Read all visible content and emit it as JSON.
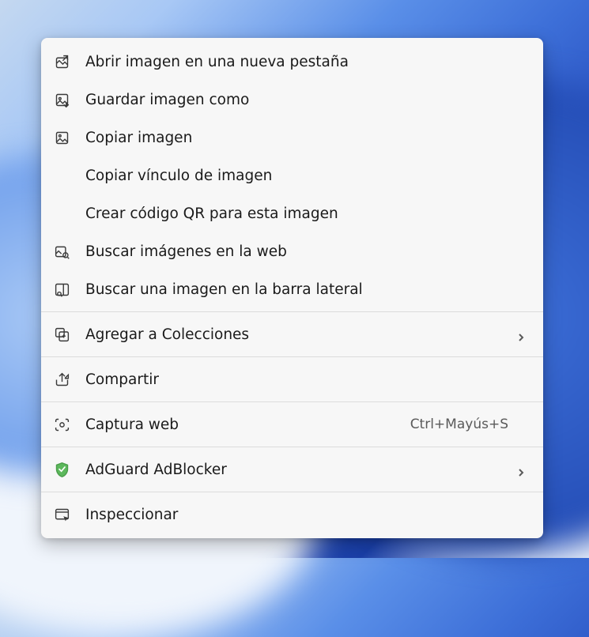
{
  "contextMenu": {
    "items": [
      {
        "label": "Abrir imagen en una nueva pestaña",
        "icon": "open-image-icon"
      },
      {
        "label": "Guardar imagen como",
        "icon": "save-image-icon"
      },
      {
        "label": "Copiar imagen",
        "icon": "copy-image-icon"
      },
      {
        "label": "Copiar vínculo de imagen",
        "icon": null
      },
      {
        "label": "Crear código QR para esta imagen",
        "icon": null
      },
      {
        "label": "Buscar imágenes en la web",
        "icon": "search-web-icon"
      },
      {
        "label": "Buscar una imagen en la barra lateral",
        "icon": "search-sidebar-icon"
      },
      {
        "separator": true
      },
      {
        "label": "Agregar a Colecciones",
        "icon": "collections-icon",
        "submenu": true
      },
      {
        "separator": true
      },
      {
        "label": "Compartir",
        "icon": "share-icon"
      },
      {
        "separator": true
      },
      {
        "label": "Captura web",
        "icon": "web-capture-icon",
        "shortcut": "Ctrl+Mayús+S"
      },
      {
        "separator": true
      },
      {
        "label": "AdGuard AdBlocker",
        "icon": "adguard-icon",
        "submenu": true
      },
      {
        "separator": true
      },
      {
        "label": "Inspeccionar",
        "icon": "inspect-icon"
      }
    ]
  }
}
